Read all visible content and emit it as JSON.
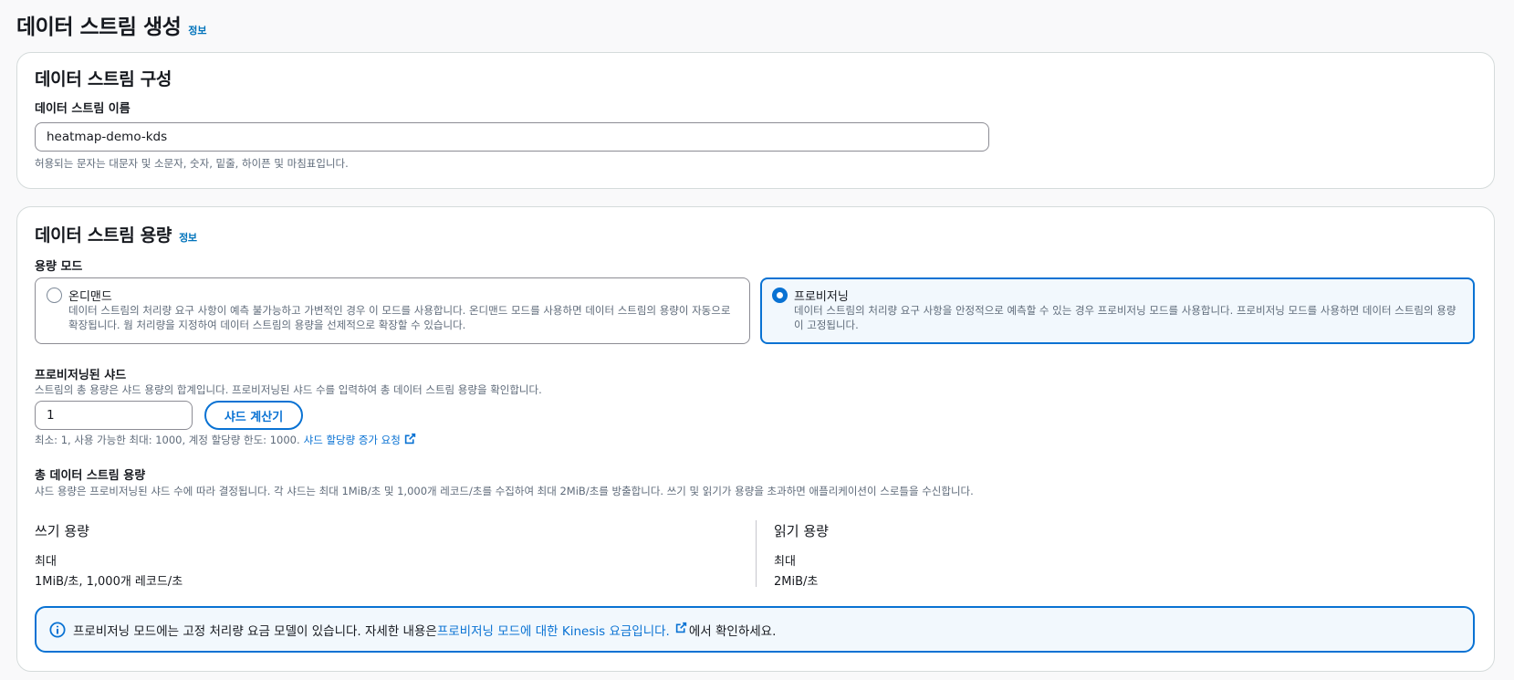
{
  "page": {
    "title": "데이터 스트림 생성",
    "info_link": "정보"
  },
  "config": {
    "title": "데이터 스트림 구성",
    "name_label": "데이터 스트림 이름",
    "name_value": "heatmap-demo-kds",
    "name_hint": "허용되는 문자는 대문자 및 소문자, 숫자, 밑줄, 하이픈 및 마침표입니다."
  },
  "capacity": {
    "title": "데이터 스트림 용량",
    "info_link": "정보",
    "mode_label": "용량 모드",
    "modes": [
      {
        "title": "온디맨드",
        "desc": "데이터 스트림의 처리량 요구 사항이 예측 불가능하고 가변적인 경우 이 모드를 사용합니다. 온디맨드 모드를 사용하면 데이터 스트림의 용량이 자동으로 확장됩니다. 웜 처리량을 지정하여 데이터 스트림의 용량을 선제적으로 확장할 수 있습니다.",
        "selected": false
      },
      {
        "title": "프로비저닝",
        "desc": "데이터 스트림의 처리량 요구 사항을 안정적으로 예측할 수 있는 경우 프로비저닝 모드를 사용합니다. 프로비저닝 모드를 사용하면 데이터 스트림의 용량이 고정됩니다.",
        "selected": true
      }
    ],
    "shards_label": "프로비저닝된 샤드",
    "shards_desc": "스트림의 총 용량은 샤드 용량의 합계입니다. 프로비저닝된 샤드 수를 입력하여 총 데이터 스트림 용량을 확인합니다.",
    "shards_value": "1",
    "calculator_button": "샤드 계산기",
    "shards_limits": "최소: 1, 사용 가능한 최대: 1000, 계정 할당량 한도: 1000.",
    "quota_link": "샤드 할당량 증가 요청",
    "total_label": "총 데이터 스트림 용량",
    "total_desc": "샤드 용량은 프로비저닝된 샤드 수에 따라 결정됩니다. 각 샤드는 최대 1MiB/초 및 1,000개 레코드/초를 수집하여 최대 2MiB/초를 방출합니다. 쓰기 및 읽기가 용량을 초과하면 애플리케이션이 스로틀을 수신합니다.",
    "write": {
      "title": "쓰기 용량",
      "max_label": "최대",
      "value": "1MiB/초, 1,000개 레코드/초"
    },
    "read": {
      "title": "읽기 용량",
      "max_label": "최대",
      "value": "2MiB/초"
    },
    "alert": {
      "text_before": "프로비저닝 모드에는 고정 처리량 요금 모델이 있습니다. 자세한 내용은 ",
      "link": "프로비저닝 모드에 대한 Kinesis 요금입니다.",
      "text_after": "에서 확인하세요."
    }
  },
  "colors": {
    "accent": "#0972d3",
    "info_bg": "#f2f8fd",
    "border": "#d5dbdb"
  }
}
